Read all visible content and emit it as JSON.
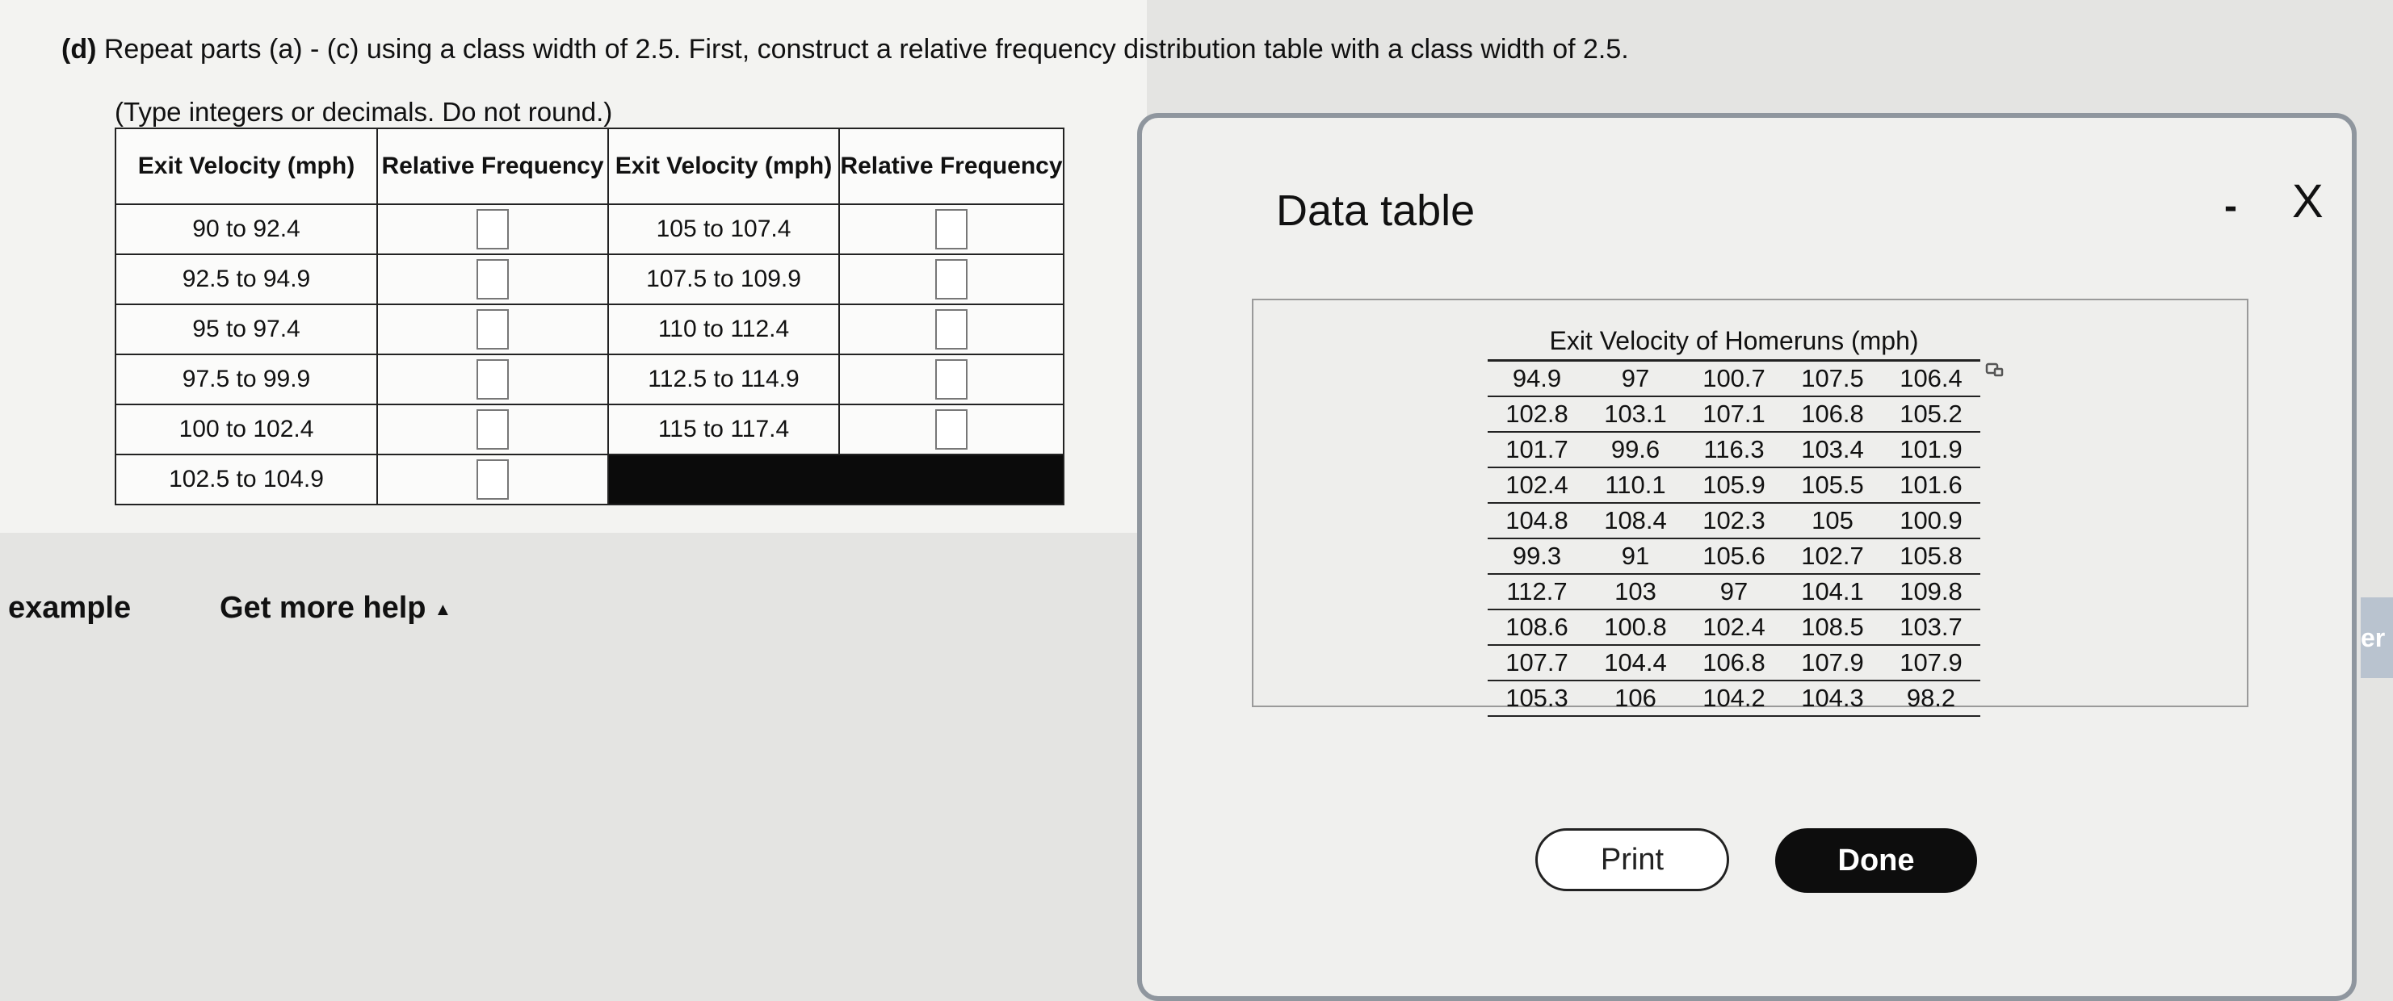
{
  "question": {
    "part": "(d)",
    "text": "Repeat parts (a) - (c) using a class width of 2.5. First, construct a relative frequency distribution table with a class width of 2.5."
  },
  "hint": "(Type integers or decimals. Do not round.)",
  "answer_table": {
    "headers": [
      "Exit Velocity (mph)",
      "Relative Frequency",
      "Exit Velocity (mph)",
      "Relative Frequency"
    ],
    "left_classes": [
      "90 to 92.4",
      "92.5 to 94.9",
      "95 to 97.4",
      "97.5 to 99.9",
      "100 to 102.4",
      "102.5 to 104.9"
    ],
    "right_classes": [
      "105 to 107.4",
      "107.5 to 109.9",
      "110 to 112.4",
      "112.5 to 114.9",
      "115 to 117.4"
    ]
  },
  "footer": {
    "example_label": "example",
    "help_label": "Get more help",
    "edge_text": "er"
  },
  "dialog": {
    "title": "Data table",
    "minimize_label": "-",
    "close_label": "X",
    "table_caption": "Exit Velocity of Homeruns (mph)",
    "rows": [
      [
        "94.9",
        "97",
        "100.7",
        "107.5",
        "106.4"
      ],
      [
        "102.8",
        "103.1",
        "107.1",
        "106.8",
        "105.2"
      ],
      [
        "101.7",
        "99.6",
        "116.3",
        "103.4",
        "101.9"
      ],
      [
        "102.4",
        "110.1",
        "105.9",
        "105.5",
        "101.6"
      ],
      [
        "104.8",
        "108.4",
        "102.3",
        "105",
        "100.9"
      ],
      [
        "99.3",
        "91",
        "105.6",
        "102.7",
        "105.8"
      ],
      [
        "112.7",
        "103",
        "97",
        "104.1",
        "109.8"
      ],
      [
        "108.6",
        "100.8",
        "102.4",
        "108.5",
        "103.7"
      ],
      [
        "107.7",
        "104.4",
        "106.8",
        "107.9",
        "107.9"
      ],
      [
        "105.3",
        "106",
        "104.2",
        "104.3",
        "98.2"
      ]
    ],
    "print_label": "Print",
    "done_label": "Done"
  }
}
